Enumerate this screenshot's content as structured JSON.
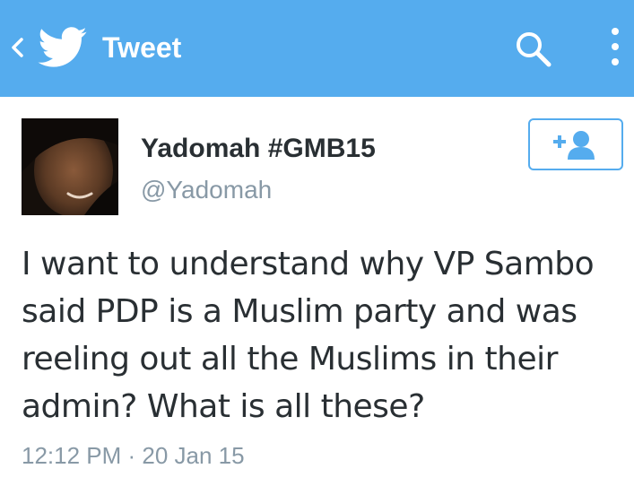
{
  "appbar": {
    "title": "Tweet",
    "background_color": "#55acee",
    "back_icon": "chevron-left-icon",
    "logo_icon": "twitter-bird-icon",
    "search_icon": "search-icon",
    "overflow_icon": "vertical-dots-icon"
  },
  "tweet": {
    "display_name": "Yadomah #GMB15",
    "handle": "@Yadomah",
    "text": "I want to understand why VP Sambo said PDP is a Muslim party and was reeling out all the Muslims in their admin? What is all these?",
    "timestamp": "12:12 PM · 20 Jan 15",
    "follow_icon": "add-user-icon"
  },
  "colors": {
    "accent": "#55acee",
    "text_primary": "#292f33",
    "text_secondary": "#8899a6"
  }
}
